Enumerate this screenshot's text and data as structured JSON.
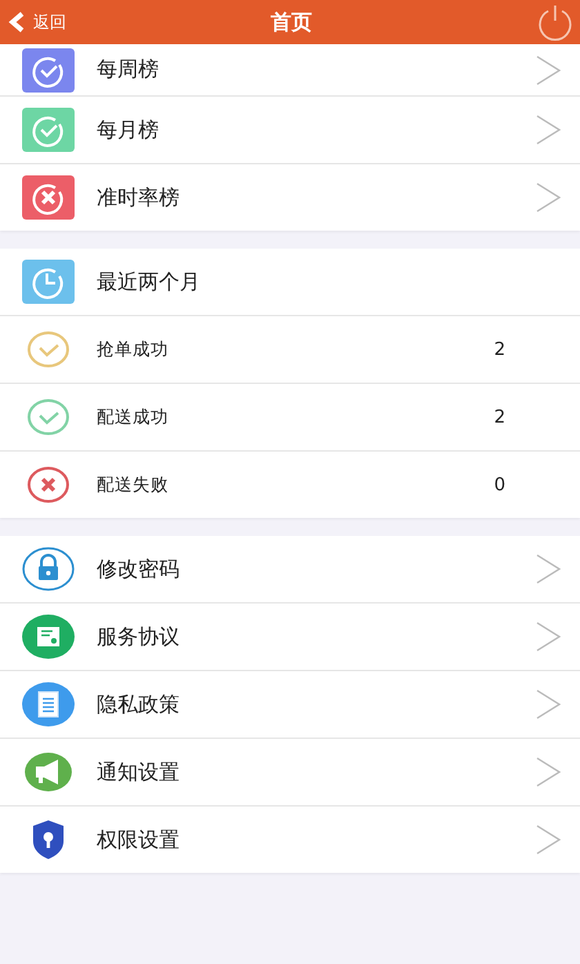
{
  "header": {
    "back_label": "返回",
    "title": "首页"
  },
  "sections": [
    {
      "rows": [
        {
          "label": "每周榜",
          "kind": "main",
          "icon": {
            "kind": "check-square",
            "color": "#7b86ee"
          },
          "chevron": true
        },
        {
          "label": "每月榜",
          "kind": "main",
          "icon": {
            "kind": "check-square",
            "color": "#6dd6a4"
          },
          "chevron": true
        },
        {
          "label": "准时率榜",
          "kind": "main",
          "icon": {
            "kind": "cross-square",
            "color": "#ec5e68"
          },
          "chevron": true
        }
      ]
    },
    {
      "rows": [
        {
          "label": "最近两个月",
          "kind": "main",
          "icon": {
            "kind": "clock-square",
            "color": "#6cc0ec"
          },
          "chevron": false
        },
        {
          "label": "抢单成功",
          "kind": "stat",
          "icon": {
            "kind": "check-ring",
            "color": "#e8c77c"
          },
          "value": "2",
          "chevron": false
        },
        {
          "label": "配送成功",
          "kind": "stat",
          "icon": {
            "kind": "check-ring",
            "color": "#82d3a6"
          },
          "value": "2",
          "chevron": false
        },
        {
          "label": "配送失败",
          "kind": "stat",
          "icon": {
            "kind": "cross-ring",
            "color": "#dd5a5e"
          },
          "value": "0",
          "chevron": false
        }
      ]
    },
    {
      "rows": [
        {
          "label": "修改密码",
          "kind": "main",
          "icon": {
            "kind": "lock",
            "color": "#2c8fd0"
          },
          "chevron": true
        },
        {
          "label": "服务协议",
          "kind": "main",
          "icon": {
            "kind": "document-star",
            "color": "#1fae62"
          },
          "chevron": true
        },
        {
          "label": "隐私政策",
          "kind": "main",
          "icon": {
            "kind": "document",
            "color": "#3e9bec"
          },
          "chevron": true
        },
        {
          "label": "通知设置",
          "kind": "main",
          "icon": {
            "kind": "megaphone",
            "color": "#5fb04c"
          },
          "chevron": true
        },
        {
          "label": "权限设置",
          "kind": "main",
          "icon": {
            "kind": "shield",
            "color": "#2f4fbe"
          },
          "chevron": true
        }
      ]
    }
  ]
}
